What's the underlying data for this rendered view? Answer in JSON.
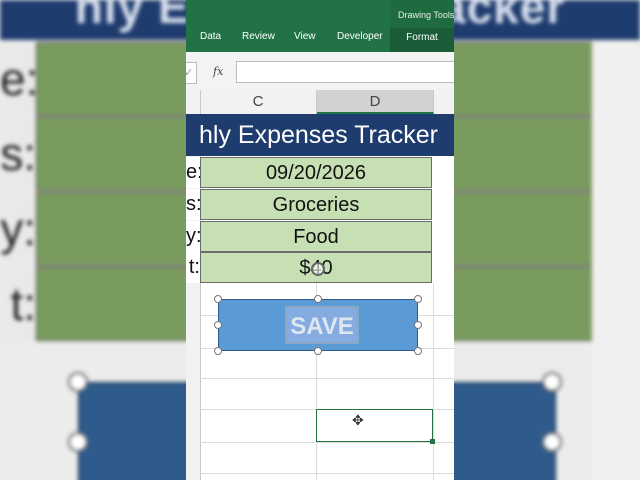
{
  "ribbon": {
    "tabs": [
      "Data",
      "Review",
      "View",
      "Developer"
    ],
    "context_group": "Drawing Tools",
    "context_tab": "Format"
  },
  "formula_bar": {
    "fx": "fx",
    "cancel": "✓",
    "value": ""
  },
  "columns": [
    "C",
    "D"
  ],
  "sheet": {
    "title": "hly Expenses Tracker",
    "rows": [
      {
        "label": "e:",
        "value": "09/20/2026"
      },
      {
        "label": "s:",
        "value": "Groceries"
      },
      {
        "label": "y:",
        "value": "Food"
      },
      {
        "label": "t:",
        "value": "$40"
      }
    ]
  },
  "shape": {
    "label": "SAVE",
    "fill": "#5b9bd5"
  },
  "background": {
    "title": "hly Expenses Tracker",
    "labels": [
      "e:",
      "s:",
      "y:",
      "t:"
    ]
  },
  "colors": {
    "ribbon": "#217346",
    "title_band": "#1f3c6e",
    "input_cell": "#c6e0b4"
  }
}
